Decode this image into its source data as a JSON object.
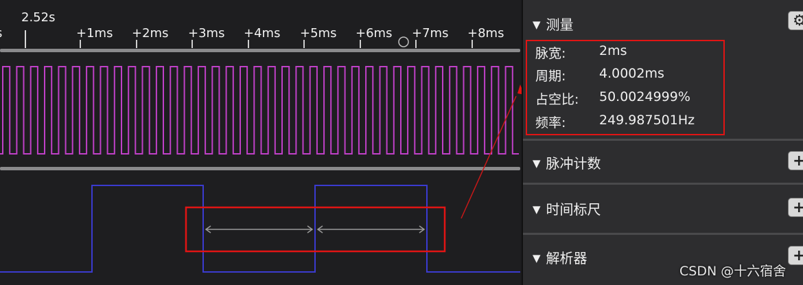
{
  "timeline": {
    "cursor_time": "2.52s",
    "partial_label": "s",
    "ticks": [
      "+1ms",
      "+2ms",
      "+3ms",
      "+4ms",
      "+5ms",
      "+6ms",
      "+7ms",
      "+8ms"
    ]
  },
  "panel": {
    "measure": {
      "title": "测量",
      "rows": [
        {
          "key": "脉宽:",
          "value": "2ms"
        },
        {
          "key": "周期:",
          "value": "4.0002ms"
        },
        {
          "key": "占空比:",
          "value": "50.0024999%"
        },
        {
          "key": "频率:",
          "value": "249.987501Hz"
        }
      ]
    },
    "pulse_count": {
      "title": "脉冲计数"
    },
    "time_ruler": {
      "title": "时间标尺"
    },
    "analyzer": {
      "title": "解析器"
    }
  },
  "colors": {
    "signal1": "#c040c8",
    "signal2": "#3b3bd0",
    "highlight": "#e11414",
    "measure_arrow": "#9a9a9a"
  },
  "icons": {
    "section_toggle": "triangle-down-icon",
    "settings": "gear-icon",
    "add": "plus-icon",
    "mouse_cursor": "circle-cursor-icon"
  },
  "watermark": "CSDN @十六宿舍"
}
